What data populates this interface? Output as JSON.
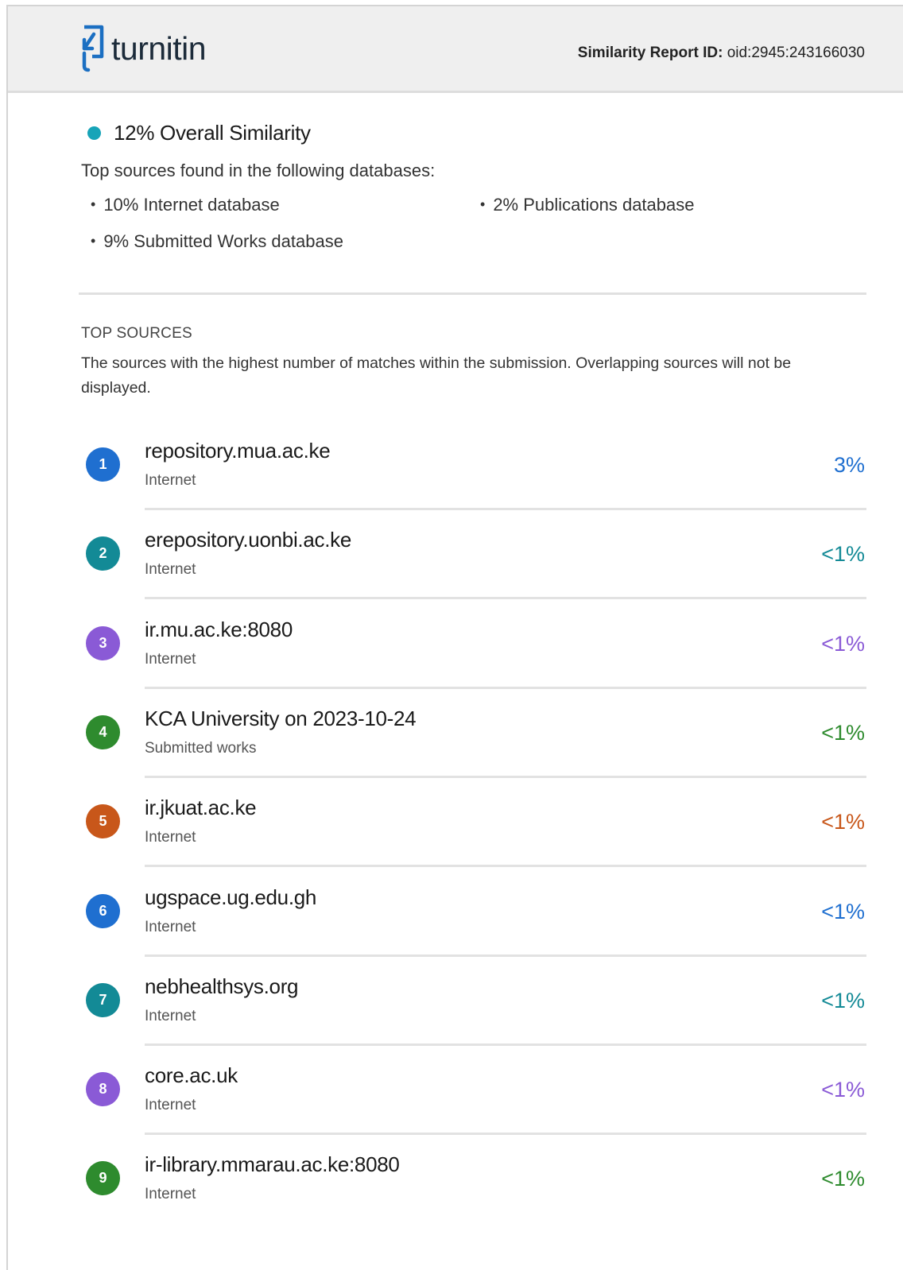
{
  "header": {
    "logo_text": "turnitin",
    "report_id_label": "Similarity Report ID:",
    "report_id_value": "oid:2945:243166030"
  },
  "summary": {
    "overall": "12% Overall Similarity",
    "intro": "Top sources found in the following databases:",
    "databases": [
      "10% Internet database",
      "2% Publications database",
      "9% Submitted Works database"
    ]
  },
  "top_sources": {
    "title": "TOP SOURCES",
    "description": "The sources with the highest number of matches within the submission. Overlapping sources will not be displayed.",
    "items": [
      {
        "num": "1",
        "name": "repository.mua.ac.ke",
        "type": "Internet",
        "pct": "3%",
        "color": "#1f6fd0"
      },
      {
        "num": "2",
        "name": "erepository.uonbi.ac.ke",
        "type": "Internet",
        "pct": "<1%",
        "color": "#138a96"
      },
      {
        "num": "3",
        "name": "ir.mu.ac.ke:8080",
        "type": "Internet",
        "pct": "<1%",
        "color": "#8a5ad6"
      },
      {
        "num": "4",
        "name": "KCA University on 2023-10-24",
        "type": "Submitted works",
        "pct": "<1%",
        "color": "#2e8b2e"
      },
      {
        "num": "5",
        "name": "ir.jkuat.ac.ke",
        "type": "Internet",
        "pct": "<1%",
        "color": "#c8571a"
      },
      {
        "num": "6",
        "name": "ugspace.ug.edu.gh",
        "type": "Internet",
        "pct": "<1%",
        "color": "#1f6fd0"
      },
      {
        "num": "7",
        "name": "nebhealthsys.org",
        "type": "Internet",
        "pct": "<1%",
        "color": "#138a96"
      },
      {
        "num": "8",
        "name": "core.ac.uk",
        "type": "Internet",
        "pct": "<1%",
        "color": "#8a5ad6"
      },
      {
        "num": "9",
        "name": "ir-library.mmarau.ac.ke:8080",
        "type": "Internet",
        "pct": "<1%",
        "color": "#2e8b2e"
      }
    ]
  },
  "colors": {
    "overall_dot": "#17a4b8",
    "logo": "#1b6fc2"
  }
}
